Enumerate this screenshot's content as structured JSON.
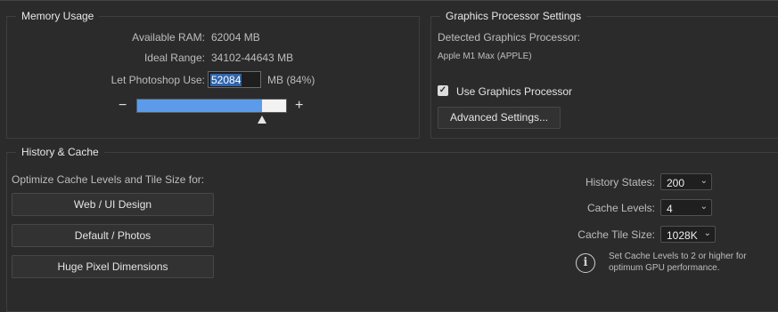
{
  "memory": {
    "title": "Memory Usage",
    "available_label": "Available RAM:",
    "available_value": "62004 MB",
    "ideal_label": "Ideal Range:",
    "ideal_value": "34102-44643 MB",
    "use_label": "Let Photoshop Use:",
    "use_value": "52084",
    "use_suffix": "MB (84%)",
    "minus": "−",
    "plus": "+",
    "slider_fraction": 0.84
  },
  "gpu": {
    "title": "Graphics Processor Settings",
    "detected_label": "Detected Graphics Processor:",
    "detected_value": "Apple M1 Max (APPLE)",
    "use_gpu_label": "Use Graphics Processor",
    "use_gpu_checked": true,
    "advanced_button": "Advanced Settings..."
  },
  "history": {
    "title": "History & Cache",
    "optimize_label": "Optimize Cache Levels and Tile Size for:",
    "buttons": [
      "Web / UI Design",
      "Default / Photos",
      "Huge Pixel Dimensions"
    ],
    "history_states_label": "History States:",
    "history_states_value": "200",
    "cache_levels_label": "Cache Levels:",
    "cache_levels_value": "4",
    "cache_tile_label": "Cache Tile Size:",
    "cache_tile_value": "1028K",
    "info_text_1": "Set Cache Levels to 2 or higher for",
    "info_text_2": "optimum GPU performance."
  },
  "icons": {
    "info": "info-circle-icon",
    "chevron": "chevron-down-icon",
    "slider_thumb": "triangle-up-icon"
  },
  "colors": {
    "background": "#2b2b2b",
    "slider_fill": "#5b9bea",
    "selection": "#2f65ad"
  }
}
